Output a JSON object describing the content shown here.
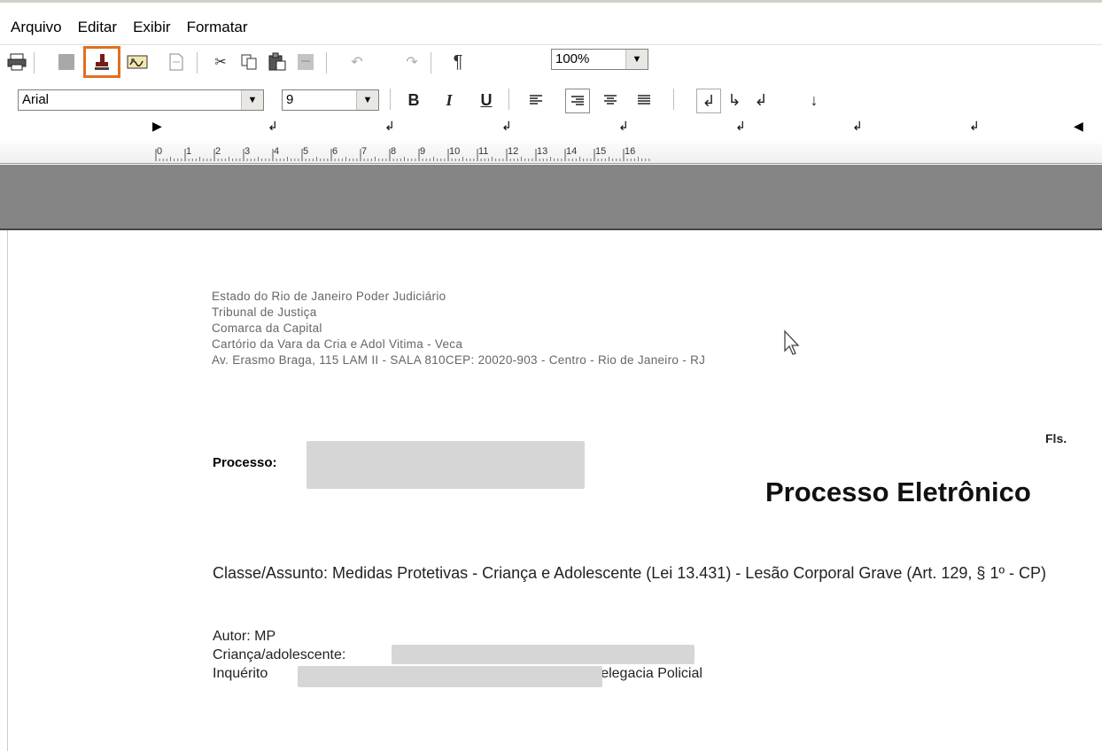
{
  "menu": {
    "items": [
      "Arquivo",
      "Editar",
      "Exibir",
      "Formatar"
    ]
  },
  "toolbar": {
    "zoom": "100%",
    "font": "Arial",
    "size": "9",
    "icons": [
      "print-icon",
      "blank-icon",
      "stamp-icon",
      "signature-icon",
      "document-icon",
      "cut-icon",
      "copy-icon",
      "paste-icon",
      "paste-special-icon",
      "undo-icon",
      "redo-icon",
      "pilcrow-icon"
    ],
    "format_labels": {
      "bold": "B",
      "italic": "I",
      "underline": "U",
      "pilcrow": "¶"
    },
    "highlight_color": "#e07020"
  },
  "ruler": {
    "numbers": [
      "0",
      "1",
      "2",
      "3",
      "4",
      "5",
      "6",
      "7",
      "8",
      "9",
      "10",
      "11",
      "12",
      "13",
      "14",
      "15",
      "16"
    ]
  },
  "document": {
    "header_lines": [
      "Estado do Rio de Janeiro Poder Judiciário",
      "Tribunal de Justiça",
      "Comarca da Capital",
      "Cartório da Vara da Cria e Adol Vitima - Veca",
      "Av. Erasmo Braga, 115 LAM II - SALA 810CEP: 20020-903 - Centro - Rio de Janeiro - RJ"
    ],
    "fls_label": "Fls.",
    "processo_label": "Processo:",
    "title": "Processo Eletrônico",
    "classe": "Classe/Assunto: Medidas Protetivas - Criança e Adolescente (Lei 13.431) - Lesão Corporal Grave (Art. 129, § 1º - CP)",
    "autor": "Autor: MP",
    "crianca_label": "Criança/adolescente:",
    "inquerito_label": "Inquérito",
    "inquerito_suffix": "ª Delegacia Policial"
  }
}
